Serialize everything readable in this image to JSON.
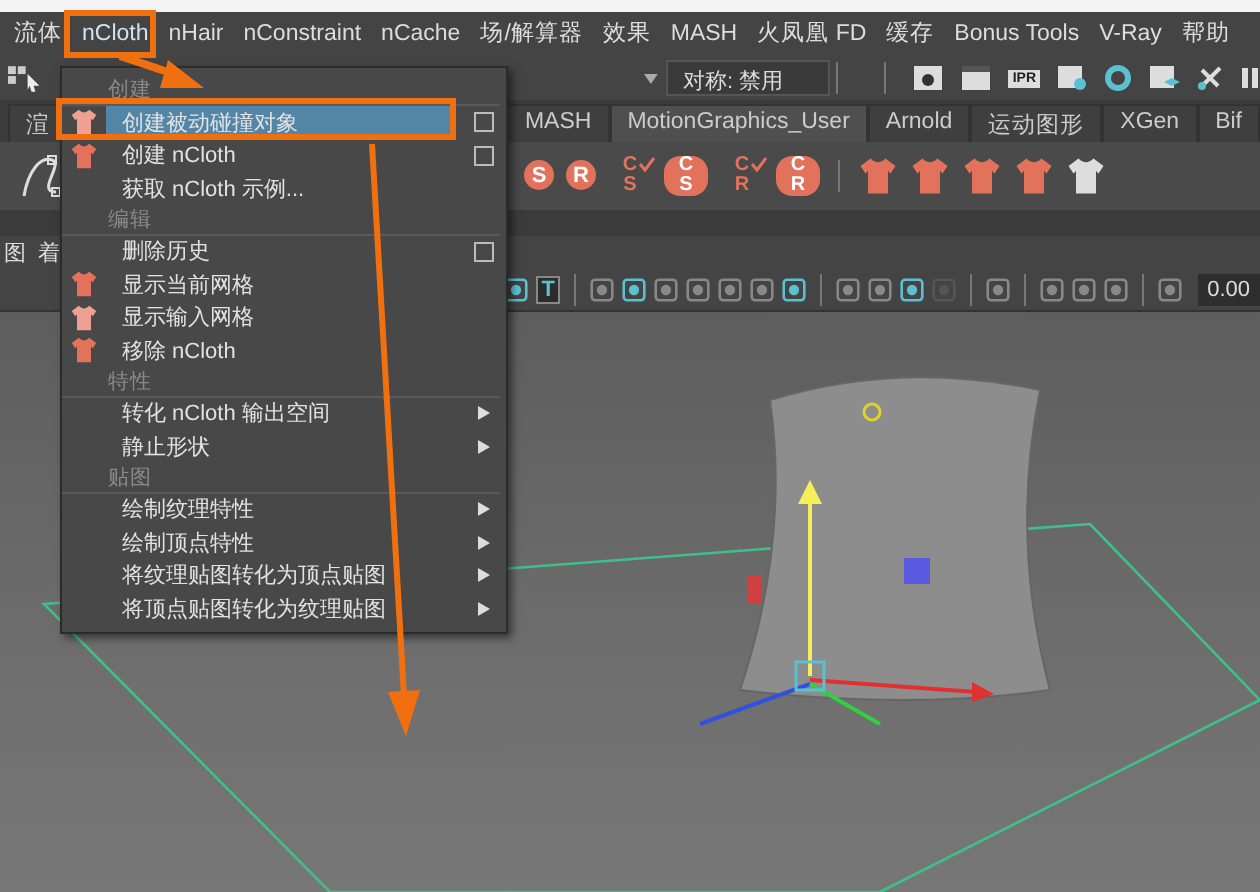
{
  "menubar": [
    {
      "label": "流体",
      "selected": false
    },
    {
      "label": "nCloth",
      "selected": true
    },
    {
      "label": "nHair",
      "selected": false
    },
    {
      "label": "nConstraint",
      "selected": false
    },
    {
      "label": "nCache",
      "selected": false
    },
    {
      "label": "场/解算器",
      "selected": false
    },
    {
      "label": "效果",
      "selected": false
    },
    {
      "label": "MASH",
      "selected": false
    },
    {
      "label": "火凤凰 FD",
      "selected": false
    },
    {
      "label": "缓存",
      "selected": false
    },
    {
      "label": "Bonus Tools",
      "selected": false
    },
    {
      "label": "V-Ray",
      "selected": false
    },
    {
      "label": "帮助",
      "selected": false
    }
  ],
  "toolbar": {
    "symmetry": "对称: 禁用",
    "ipr": "IPR"
  },
  "shelf_tabs": [
    {
      "label": "渲",
      "selected": false
    },
    {
      "label": "MASH",
      "selected": false
    },
    {
      "label": "MotionGraphics_User",
      "selected": true
    },
    {
      "label": "Arnold",
      "selected": false
    },
    {
      "label": "运动图形",
      "selected": false
    },
    {
      "label": "XGen",
      "selected": false
    },
    {
      "label": "Bif",
      "selected": false
    }
  ],
  "shelf_tools": [
    {
      "kind": "circle",
      "text": "S"
    },
    {
      "kind": "circle",
      "text": "R"
    },
    {
      "kind": "check",
      "top": "C",
      "bottom": "S"
    },
    {
      "kind": "badge",
      "top": "C",
      "bottom": "S"
    },
    {
      "kind": "check",
      "top": "C",
      "bottom": "R"
    },
    {
      "kind": "badge",
      "top": "C",
      "bottom": "R"
    }
  ],
  "panel_menu": [
    "图",
    "着"
  ],
  "panel_toolbar": {
    "text_tool": "T",
    "value": "0.00"
  },
  "menu": [
    {
      "kind": "heading",
      "label": "创建"
    },
    {
      "kind": "item",
      "label": "创建被动碰撞对象",
      "icon": true,
      "option_box": true,
      "submenu": false,
      "selected": true
    },
    {
      "kind": "item",
      "label": "创建 nCloth",
      "icon": true,
      "option_box": true,
      "submenu": false,
      "selected": false
    },
    {
      "kind": "item",
      "label": "获取 nCloth 示例...",
      "icon": false,
      "option_box": false,
      "submenu": false,
      "selected": false
    },
    {
      "kind": "heading",
      "label": "编辑"
    },
    {
      "kind": "item",
      "label": "删除历史",
      "icon": false,
      "option_box": true,
      "submenu": false,
      "selected": false
    },
    {
      "kind": "item",
      "label": "显示当前网格",
      "icon": true,
      "option_box": false,
      "submenu": false,
      "selected": false
    },
    {
      "kind": "item",
      "label": "显示输入网格",
      "icon": true,
      "option_box": false,
      "submenu": false,
      "selected": false
    },
    {
      "kind": "item",
      "label": "移除 nCloth",
      "icon": true,
      "option_box": false,
      "submenu": false,
      "selected": false
    },
    {
      "kind": "heading",
      "label": "特性"
    },
    {
      "kind": "item",
      "label": "转化 nCloth 输出空间",
      "icon": false,
      "option_box": false,
      "submenu": true,
      "selected": false
    },
    {
      "kind": "item",
      "label": "静止形状",
      "icon": false,
      "option_box": false,
      "submenu": true,
      "selected": false
    },
    {
      "kind": "heading",
      "label": "贴图"
    },
    {
      "kind": "item",
      "label": "绘制纹理特性",
      "icon": false,
      "option_box": false,
      "submenu": true,
      "selected": false
    },
    {
      "kind": "item",
      "label": "绘制顶点特性",
      "icon": false,
      "option_box": false,
      "submenu": true,
      "selected": false
    },
    {
      "kind": "item",
      "label": "将纹理贴图转化为顶点贴图",
      "icon": false,
      "option_box": false,
      "submenu": true,
      "selected": false
    },
    {
      "kind": "item",
      "label": "将顶点贴图转化为纹理贴图",
      "icon": false,
      "option_box": false,
      "submenu": true,
      "selected": false
    }
  ]
}
